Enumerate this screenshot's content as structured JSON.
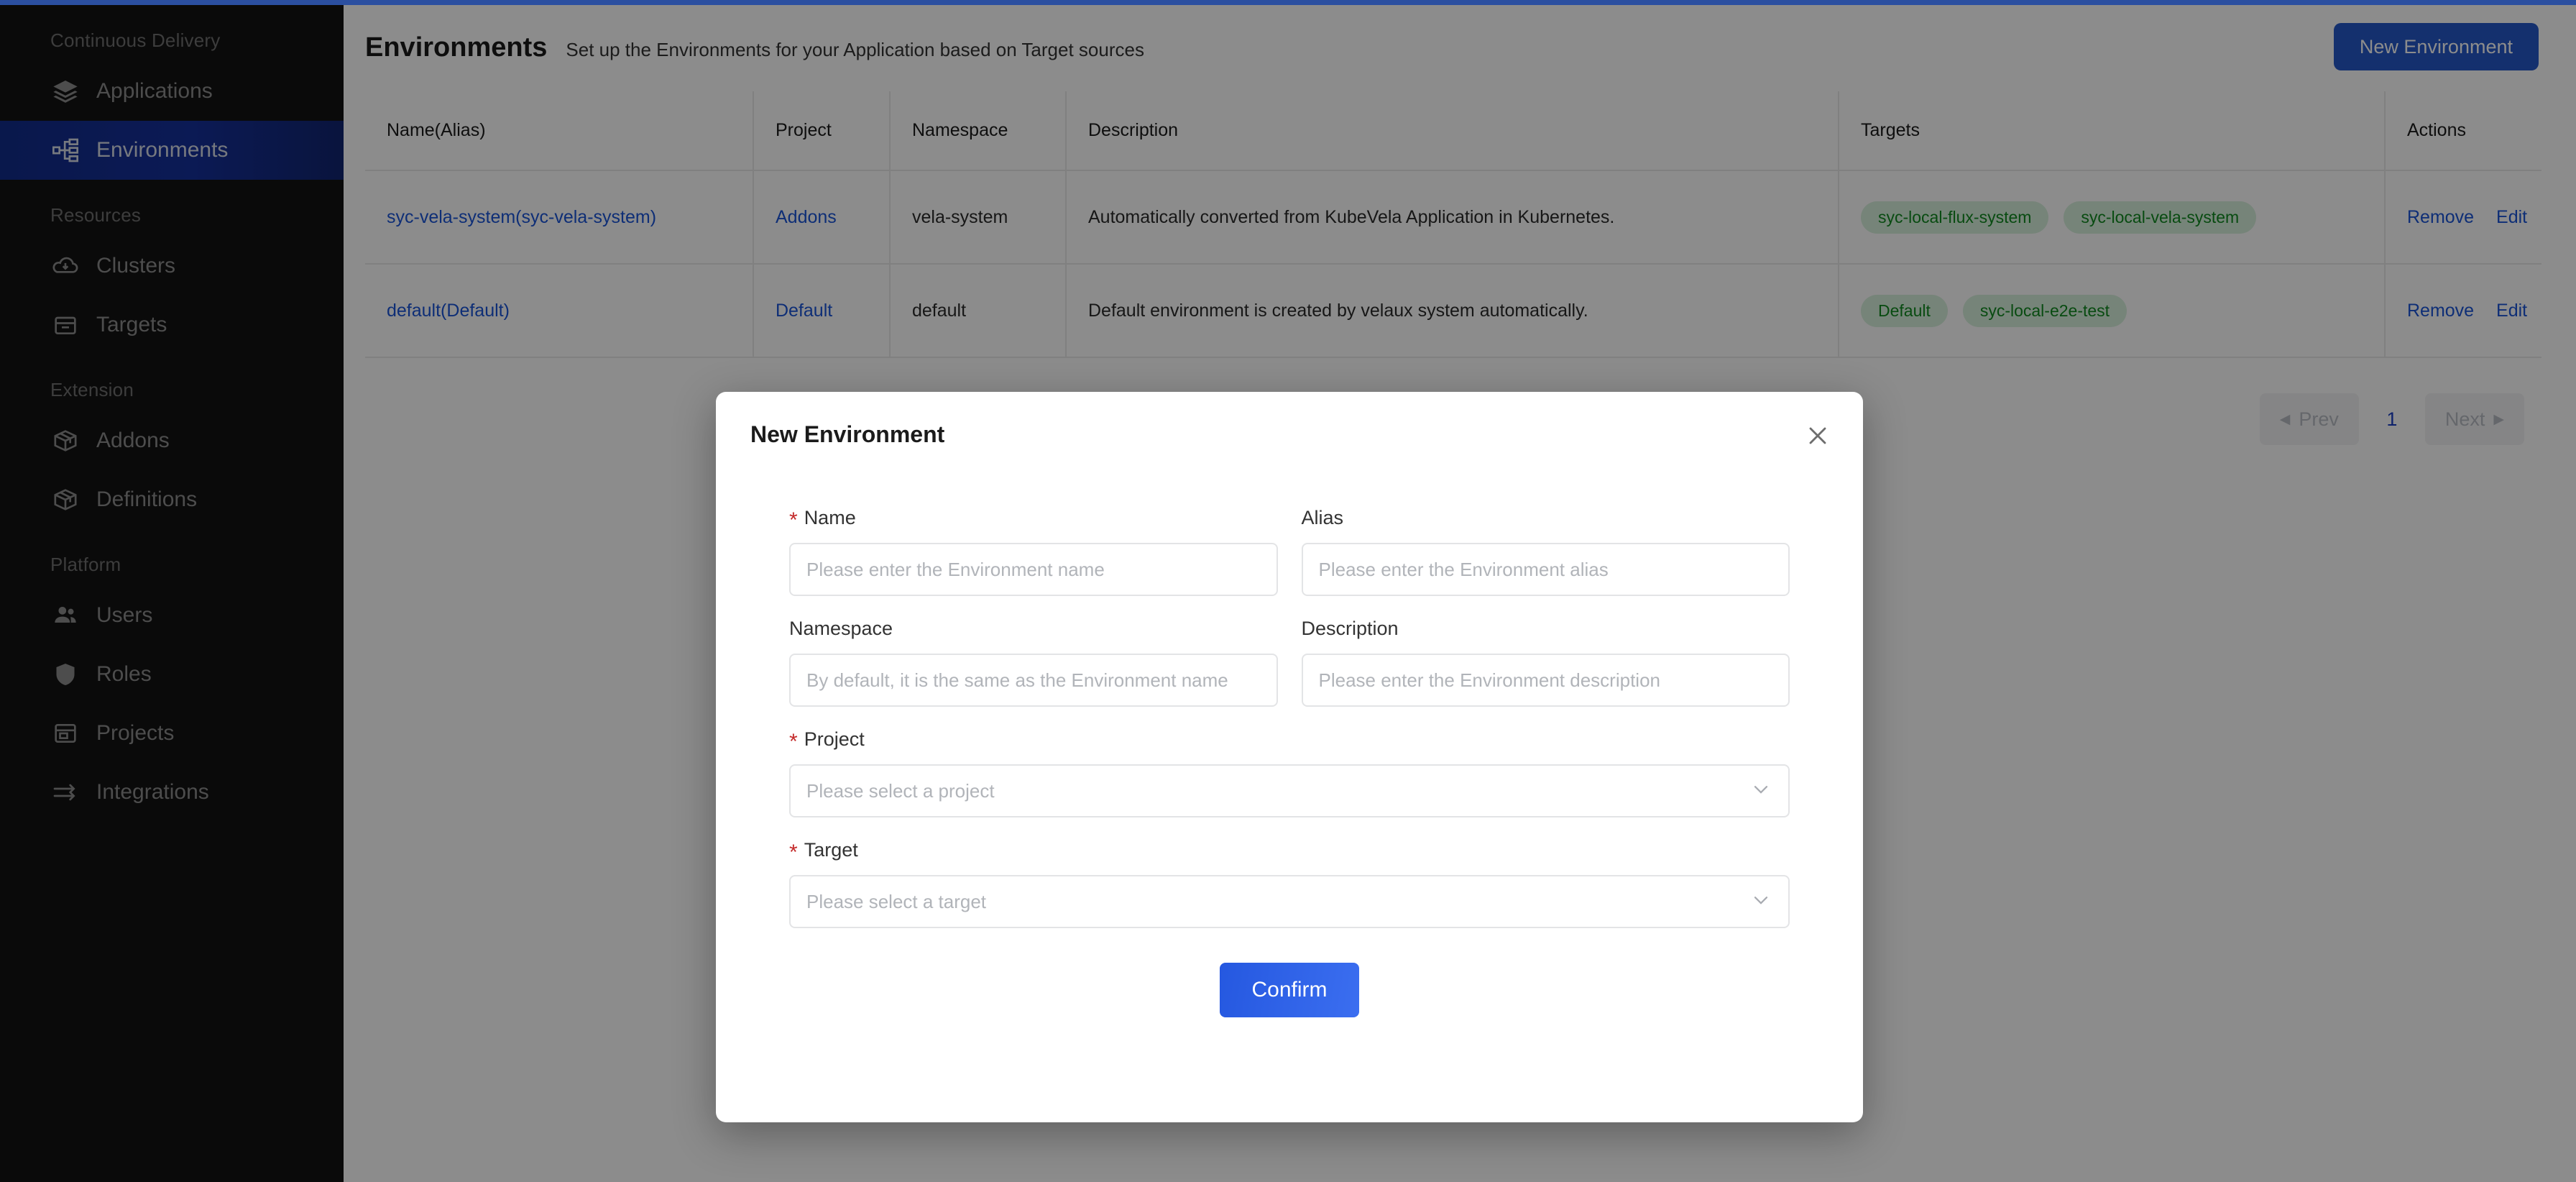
{
  "theme": {
    "accent_blue": "#2558c8",
    "sidebar_bg": "#131313",
    "active_nav_bg": "#15309b",
    "link_blue": "#1a54d8",
    "badge_green_text": "#10891f",
    "badge_green_bg": "#d8f0dc",
    "required_red": "#c42b2b"
  },
  "sidebar": {
    "groups": [
      {
        "title": "Continuous Delivery",
        "items": [
          {
            "label": "Applications",
            "icon": "layers-icon",
            "active": false
          },
          {
            "label": "Environments",
            "icon": "environments-icon",
            "active": true
          }
        ]
      },
      {
        "title": "Resources",
        "items": [
          {
            "label": "Clusters",
            "icon": "cloud-download-icon",
            "active": false
          },
          {
            "label": "Targets",
            "icon": "inbox-icon",
            "active": false
          }
        ]
      },
      {
        "title": "Extension",
        "items": [
          {
            "label": "Addons",
            "icon": "package-icon",
            "active": false
          },
          {
            "label": "Definitions",
            "icon": "package-icon",
            "active": false
          }
        ]
      },
      {
        "title": "Platform",
        "items": [
          {
            "label": "Users",
            "icon": "users-icon",
            "active": false
          },
          {
            "label": "Roles",
            "icon": "shield-icon",
            "active": false
          },
          {
            "label": "Projects",
            "icon": "window-icon",
            "active": false
          },
          {
            "label": "Integrations",
            "icon": "arrows-icon",
            "active": false
          }
        ]
      }
    ]
  },
  "header": {
    "title": "Environments",
    "subtitle": "Set up the Environments for your Application based on Target sources",
    "new_button_label": "New Environment"
  },
  "table": {
    "columns": [
      "Name(Alias)",
      "Project",
      "Namespace",
      "Description",
      "Targets",
      "Actions"
    ],
    "rows": [
      {
        "name": "syc-vela-system(syc-vela-system)",
        "project": "Addons",
        "namespace": "vela-system",
        "description": "Automatically converted from KubeVela Application in Kubernetes.",
        "targets": [
          "syc-local-flux-system",
          "syc-local-vela-system"
        ],
        "actions": [
          "Remove",
          "Edit"
        ]
      },
      {
        "name": "default(Default)",
        "project": "Default",
        "namespace": "default",
        "description": "Default environment is created by velaux system automatically.",
        "targets": [
          "Default",
          "syc-local-e2e-test"
        ],
        "actions": [
          "Remove",
          "Edit"
        ]
      }
    ]
  },
  "pagination": {
    "prev_label": "Prev",
    "next_label": "Next",
    "current_page": "1"
  },
  "modal": {
    "title": "New Environment",
    "close_icon": "close-icon",
    "fields": {
      "name": {
        "label": "Name",
        "required": true,
        "value": "",
        "placeholder": "Please enter the Environment name"
      },
      "alias": {
        "label": "Alias",
        "required": false,
        "value": "",
        "placeholder": "Please enter the Environment alias"
      },
      "namespace": {
        "label": "Namespace",
        "required": false,
        "value": "",
        "placeholder": "By default, it is the same as the Environment name"
      },
      "description": {
        "label": "Description",
        "required": false,
        "value": "",
        "placeholder": "Please enter the Environment description"
      },
      "project": {
        "label": "Project",
        "required": true,
        "value": "Please select a project",
        "caret_icon": "chevron-down-icon"
      },
      "target": {
        "label": "Target",
        "required": true,
        "value": "Please select a target",
        "caret_icon": "chevron-down-icon"
      }
    },
    "confirm_label": "Confirm"
  }
}
